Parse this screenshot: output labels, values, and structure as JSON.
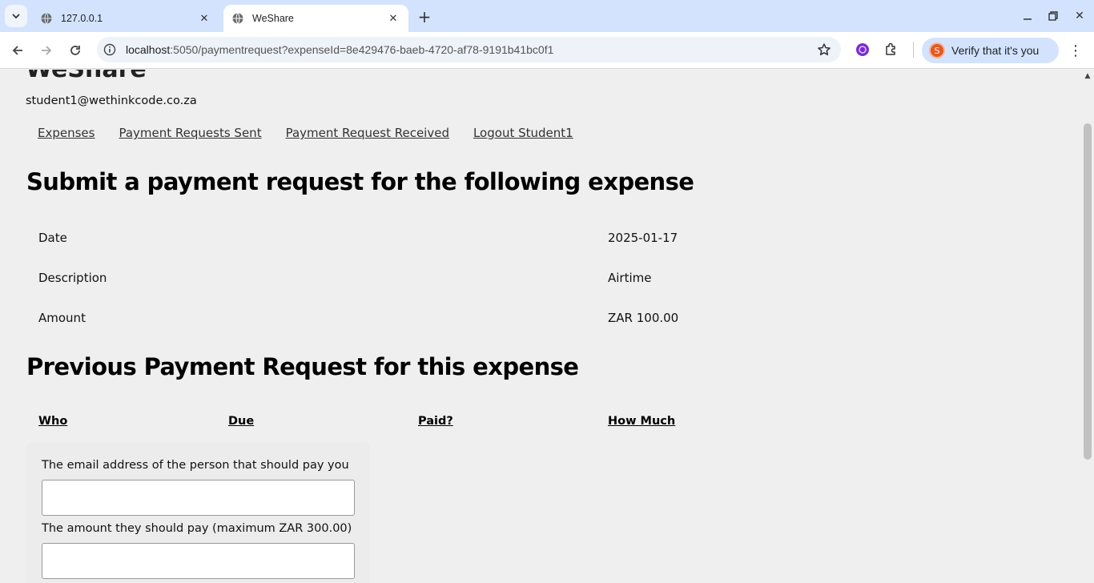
{
  "browser": {
    "tabs": [
      {
        "title": "127.0.0.1",
        "active": false
      },
      {
        "title": "WeShare",
        "active": true
      }
    ],
    "url": {
      "host": "localhost",
      "rest": ":5050/paymentrequest?expenseId=8e429476-baeb-4720-af78-9191b41bc0f1"
    },
    "profile": {
      "initial": "S",
      "label": "Verify that it's you"
    }
  },
  "page": {
    "cut_heading": "WeShare",
    "user_email": "student1@wethinkcode.co.za",
    "nav": [
      "Expenses",
      "Payment Requests Sent",
      "Payment Request Received",
      "Logout Student1"
    ],
    "submit_heading": "Submit a payment request for the following expense",
    "expense": [
      {
        "label": "Date",
        "value": "2025-01-17"
      },
      {
        "label": "Description",
        "value": "Airtime"
      },
      {
        "label": "Amount",
        "value": "ZAR 100.00"
      }
    ],
    "previous_heading": "Previous Payment Request for this expense",
    "columns": [
      "Who",
      "Due",
      "Paid?",
      "How Much"
    ],
    "form": {
      "email_label": "The email address of the person that should pay you",
      "email_value": "",
      "amount_label": "The amount they should pay (maximum ZAR 300.00)",
      "amount_value": ""
    }
  },
  "colors": {
    "tabstrip": "#d3e3fd",
    "omnibox": "#eef2f9",
    "page_bg": "#efefef"
  }
}
